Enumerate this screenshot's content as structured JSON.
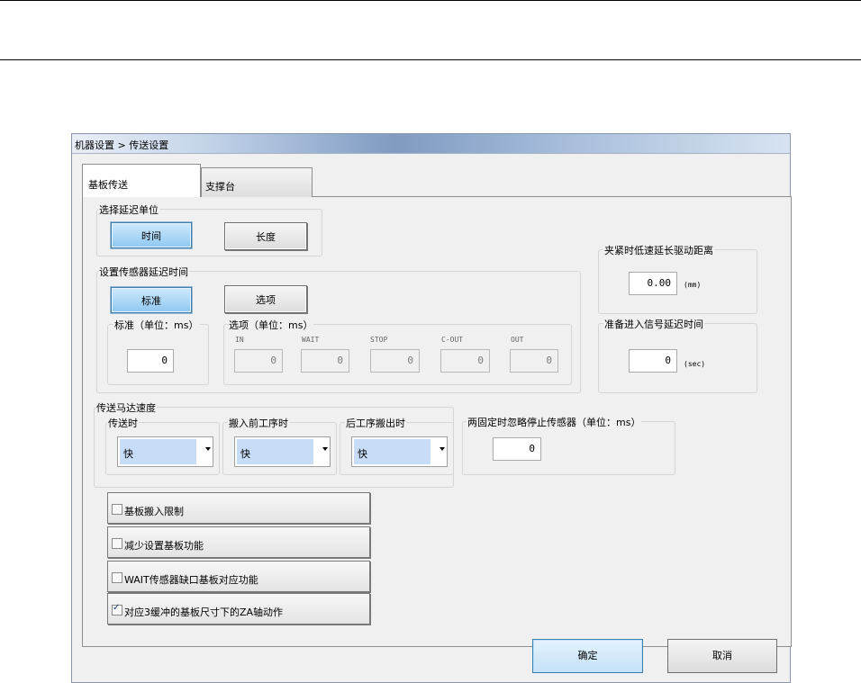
{
  "window": {
    "title": "机器设置 > 传送设置"
  },
  "tabs": [
    {
      "label": "基板传送"
    },
    {
      "label": "支撑台"
    }
  ],
  "delay_unit": {
    "label": "选择延迟单位",
    "time_label": "时间",
    "length_label": "长度"
  },
  "sensor_delay": {
    "label": "设置传感器延迟时间",
    "standard_button": "标准",
    "option_button": "选项",
    "standard_group_label": "标准（单位：ms）",
    "standard_value": "0",
    "option_group_label": "选项（单位：ms）",
    "options": [
      {
        "name": "IN",
        "value": "0"
      },
      {
        "name": "WAIT",
        "value": "0"
      },
      {
        "name": "STOP",
        "value": "0"
      },
      {
        "name": "C-OUT",
        "value": "0"
      },
      {
        "name": "OUT",
        "value": "0"
      }
    ]
  },
  "clamp": {
    "label": "夹紧时低速延长驱动距离",
    "value": "0.00",
    "unit": "(mm)"
  },
  "ready": {
    "label": "准备进入信号延迟时间",
    "value": "0",
    "unit": "(sec)"
  },
  "motor_speed": {
    "label": "传送马达速度",
    "groups": [
      {
        "label": "传送时",
        "value": "快"
      },
      {
        "label": "搬入前工序时",
        "value": "快"
      },
      {
        "label": "后工序搬出时",
        "value": "快"
      }
    ]
  },
  "ignore_stop": {
    "label": "两固定时忽略停止传感器（单位：ms）",
    "value": "0"
  },
  "checkboxes": [
    {
      "label": "基板搬入限制",
      "checked": false
    },
    {
      "label": "减少设置基板功能",
      "checked": false
    },
    {
      "label": "WAIT传感器缺口基板对应功能",
      "checked": false
    },
    {
      "label": "对应3缓冲的基板尺寸下的ZA轴动作",
      "checked": true
    }
  ],
  "footer": {
    "ok_label": "确定",
    "cancel_label": "取消"
  }
}
